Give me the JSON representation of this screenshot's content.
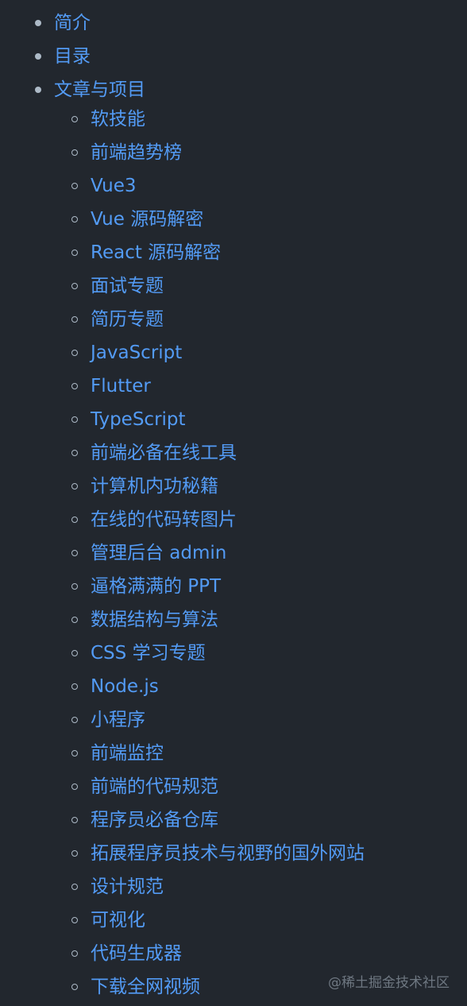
{
  "toc": {
    "top_items": [
      "简介",
      "目录",
      "文章与项目"
    ],
    "sub_items": [
      "软技能",
      "前端趋势榜",
      "Vue3",
      "Vue 源码解密",
      "React 源码解密",
      "面试专题",
      "简历专题",
      "JavaScript",
      "Flutter",
      "TypeScript",
      "前端必备在线工具",
      "计算机内功秘籍",
      "在线的代码转图片",
      "管理后台 admin",
      "逼格满满的 PPT",
      "数据结构与算法",
      "CSS 学习专题",
      "Node.js",
      "小程序",
      "前端监控",
      "前端的代码规范",
      "程序员必备仓库",
      "拓展程序员技术与视野的国外网站",
      "设计规范",
      "可视化",
      "代码生成器",
      "下载全网视频"
    ]
  },
  "watermark": "@稀土掘金技术社区",
  "colors": {
    "background": "#22272e",
    "link": "#539bf5",
    "bullet": "#adbac7"
  }
}
